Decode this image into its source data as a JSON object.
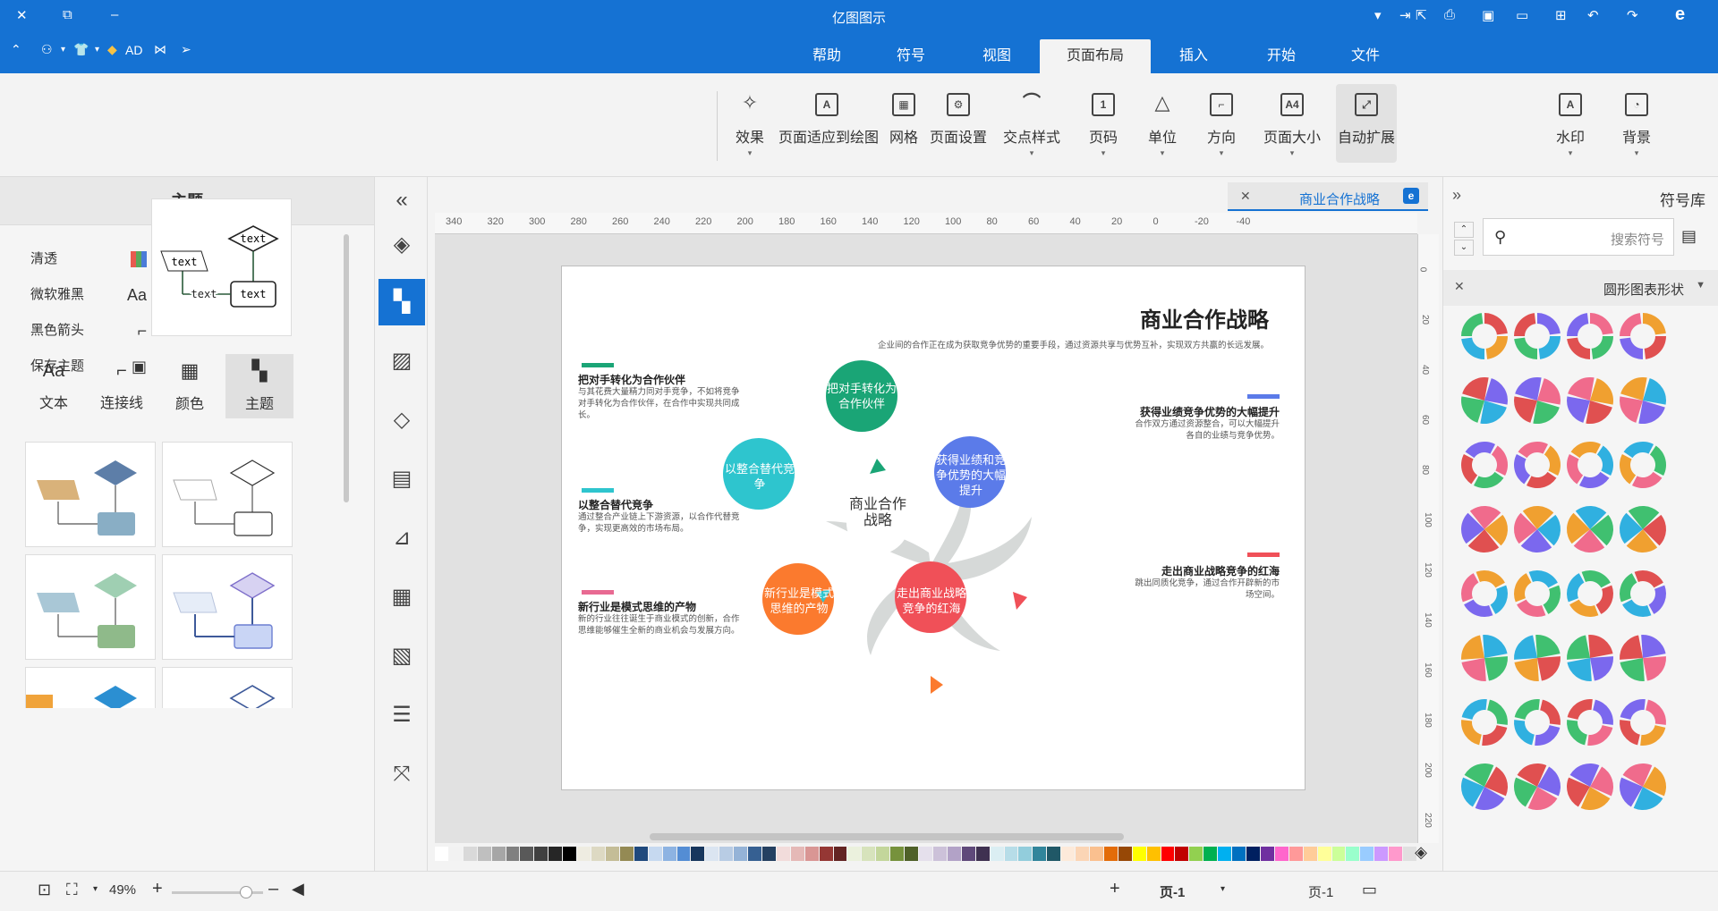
{
  "app": {
    "title": "亿图图示"
  },
  "menu": {
    "tabs": [
      "文件",
      "开始",
      "插入",
      "页面布局",
      "视图",
      "符号",
      "帮助"
    ],
    "active": "页面布局"
  },
  "quick_access": {
    "ad_label": "AD"
  },
  "ribbon": {
    "buttons": [
      {
        "label": "自动扩展",
        "icon": "auto-extend-icon"
      },
      {
        "label": "页面大小",
        "icon": "page-size-icon"
      },
      {
        "label": "方向",
        "icon": "orientation-icon"
      },
      {
        "label": "单位",
        "icon": "unit-icon"
      },
      {
        "label": "页码",
        "icon": "page-number-icon"
      },
      {
        "label": "交点样式",
        "icon": "jump-style-icon"
      },
      {
        "label": "页面设置",
        "icon": "page-setup-icon"
      },
      {
        "label": "网格",
        "icon": "grid-icon"
      },
      {
        "label": "页面适应到绘图",
        "icon": "fit-to-drawing-icon"
      },
      {
        "label": "效果",
        "icon": "effect-icon"
      },
      {
        "label": "水印",
        "icon": "watermark-icon"
      },
      {
        "label": "背景",
        "icon": "background-icon"
      }
    ]
  },
  "left_panel": {
    "header": "主题",
    "options": [
      {
        "label": "清透"
      },
      {
        "label": "微软雅黑"
      },
      {
        "label": "黑色箭头"
      },
      {
        "label": "保存主题"
      }
    ],
    "preview_text": "text",
    "tabs": [
      {
        "label": "主题"
      },
      {
        "label": "颜色"
      },
      {
        "label": "连接线"
      },
      {
        "label": "文本"
      }
    ]
  },
  "document_tab": {
    "label": "商业合作战略"
  },
  "ruler": {
    "top": [
      "340",
      "320",
      "300",
      "280",
      "260",
      "240",
      "220",
      "200",
      "180",
      "160",
      "140",
      "120",
      "100",
      "80",
      "60",
      "40",
      "20",
      "0",
      "-20",
      "-40"
    ],
    "left": [
      "0",
      "20",
      "40",
      "60",
      "80",
      "100",
      "120",
      "140",
      "160",
      "180",
      "200",
      "220"
    ]
  },
  "diagram": {
    "title": "商业合作战略",
    "intro": "企业间的合作正在成为获取竞争优势的重要手段，通过资源共享与优势互补，实现双方共赢的长远发展。",
    "center": "商业合作战略",
    "nodes": [
      {
        "text": "把对手转化为合作伙伴",
        "color": "#1aa576"
      },
      {
        "text": "获得业绩和竞争优势的大幅提升",
        "color": "#5b7be9"
      },
      {
        "text": "走出商业战略竞争的红海",
        "color": "#f05058"
      },
      {
        "text": "新行业是模式思维的产物",
        "color": "#fb7a2e"
      },
      {
        "text": "以整合替代竞争",
        "color": "#2ec5ce"
      }
    ],
    "sections": [
      {
        "heading": "把对手转化为合作伙伴",
        "body": "与其花费大量精力同对手竞争，不如将竞争对手转化为合作伙伴，在合作中实现共同成长。",
        "color": "#1aa576"
      },
      {
        "heading": "获得业绩竞争优势的大幅提升",
        "body": "合作双方通过资源整合，可以大幅提升各自的业绩与竞争优势。",
        "color": "#5b7be9"
      },
      {
        "heading": "以整合替代竞争",
        "body": "通过整合产业链上下游资源，以合作代替竞争，实现更高效的市场布局。",
        "color": "#2ec5ce"
      },
      {
        "heading": "走出商业战略竞争的红海",
        "body": "跳出同质化竞争，通过合作开辟新的市场空间。",
        "color": "#f05058"
      },
      {
        "heading": "新行业是模式思维的产物",
        "body": "新的行业往往诞生于商业模式的创新，合作思维能够催生全新的商业机会与发展方向。",
        "color": "#e86a92"
      }
    ]
  },
  "right_panel": {
    "title": "符号库",
    "search_placeholder": "搜索符号",
    "category": "圆形图表形状"
  },
  "status": {
    "page_selector": "页-1",
    "page_tab": "页-1",
    "zoom": "49%"
  },
  "palette": [
    "#ffffff",
    "#f2f2f2",
    "#d9d9d9",
    "#bfbfbf",
    "#a6a6a6",
    "#808080",
    "#595959",
    "#404040",
    "#262626",
    "#000000",
    "#eeece1",
    "#ddd9c3",
    "#c4bd97",
    "#948a54",
    "#1f497d",
    "#c6d9f0",
    "#8db3e2",
    "#548dd4",
    "#17365d",
    "#dbe5f1",
    "#b8cce4",
    "#95b3d7",
    "#366092",
    "#244061",
    "#f2dcdb",
    "#e5b9b7",
    "#d99694",
    "#953734",
    "#632423",
    "#ebf1dd",
    "#d7e3bc",
    "#c3d69b",
    "#76923c",
    "#4f6128",
    "#e5e0ec",
    "#ccc1d9",
    "#b2a2c7",
    "#5f497a",
    "#3f3151",
    "#dbeef3",
    "#b7dde8",
    "#92cddc",
    "#31859b",
    "#205867",
    "#fdeada",
    "#fbd5b5",
    "#fac08f",
    "#e36c09",
    "#974806",
    "#ffff00",
    "#ffc000",
    "#ff0000",
    "#c00000",
    "#92d050",
    "#00b050",
    "#00b0f0",
    "#0070c0",
    "#002060",
    "#7030a0",
    "#ff66cc",
    "#ff9999",
    "#ffcc99",
    "#ffff99",
    "#ccff99",
    "#99ffcc",
    "#99ccff",
    "#cc99ff",
    "#ff99cc",
    "#e0e0e0"
  ]
}
